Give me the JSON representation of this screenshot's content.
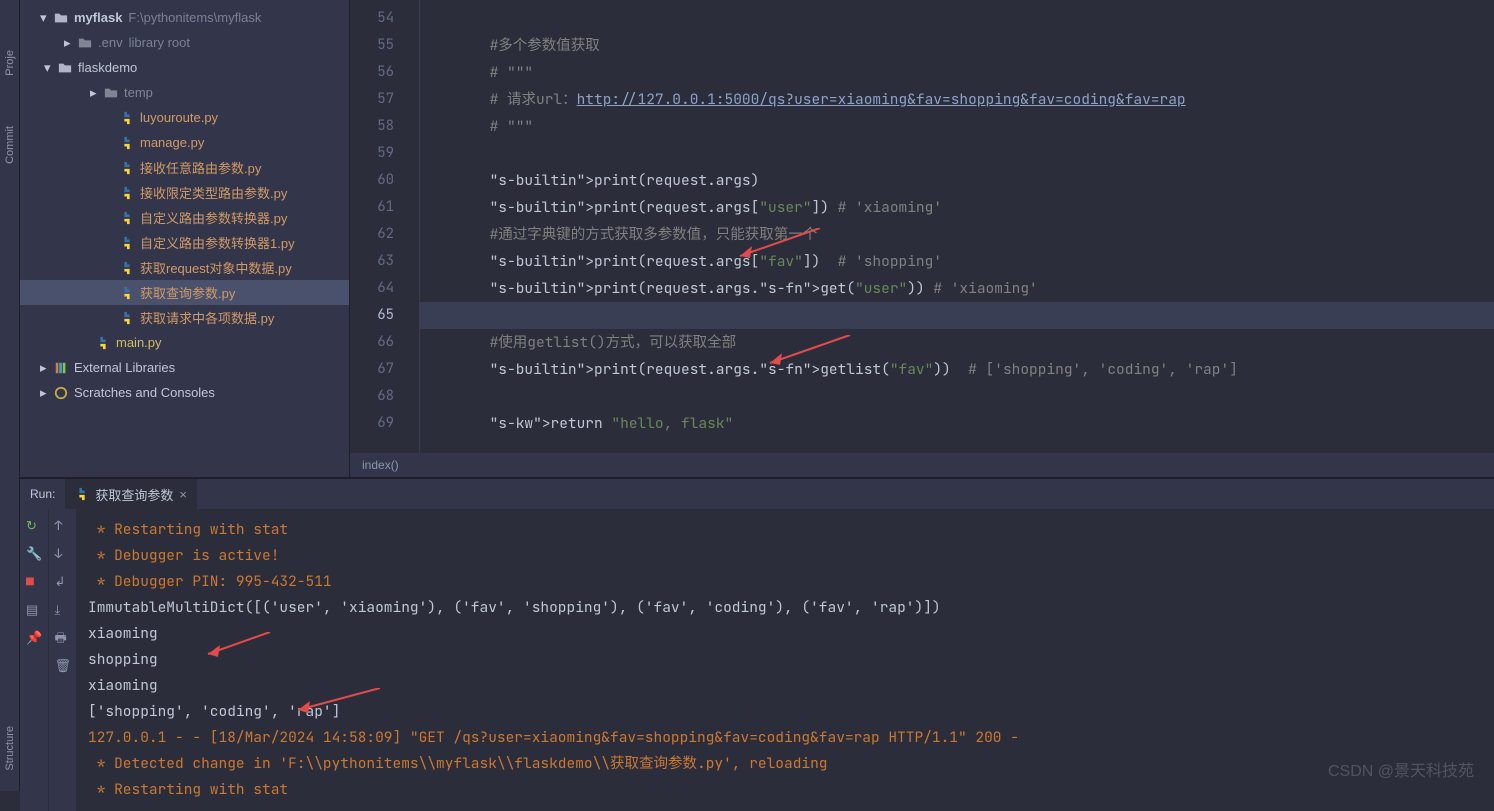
{
  "leftbar": {
    "commit": "Commit",
    "project": "Proje",
    "structure": "Structure"
  },
  "tree": {
    "root": {
      "name": "myflask",
      "path": "F:\\pythonitems\\myflask"
    },
    "env": {
      "name": ".env",
      "tag": "library root"
    },
    "folder": "flaskdemo",
    "temp": "temp",
    "files": [
      "luyouroute.py",
      "manage.py",
      "接收任意路由参数.py",
      "接收限定类型路由参数.py",
      "自定义路由参数转换器.py",
      "自定义路由参数转换器1.py",
      "获取request对象中数据.py",
      "获取查询参数.py",
      "获取请求中各项数据.py"
    ],
    "selectedFile": "获取查询参数.py",
    "main": "main.py",
    "extlib": "External Libraries",
    "scratches": "Scratches and Consoles"
  },
  "editor": {
    "startLine": 54,
    "currentLine": 65,
    "lines": [
      "",
      "        #多个参数值获取",
      "        # \"\"\"",
      "        # 请求url：http://127.0.0.1:5000/qs?user=xiaoming&fav=shopping&fav=coding&fav=rap",
      "        # \"\"\"",
      "",
      "        print(request.args)",
      "        print(request.args[\"user\"]) # 'xiaoming'",
      "        #通过字典键的方式获取多参数值，只能获取第一个",
      "        print(request.args[\"fav\"])  # 'shopping'",
      "        print(request.args.get(\"user\")) # 'xiaoming'",
      "",
      "        #使用getlist()方式，可以获取全部",
      "        print(request.args.getlist(\"fav\"))  # ['shopping', 'coding', 'rap']",
      "",
      "        return \"hello, flask\""
    ],
    "crumb": "index()"
  },
  "run": {
    "label": "Run:",
    "tabName": "获取查询参数",
    "lines": [
      {
        "t": " * Restarting with stat",
        "c": "red"
      },
      {
        "t": " * Debugger is active!",
        "c": "red"
      },
      {
        "t": " * Debugger PIN: 995-432-511",
        "c": "red"
      },
      {
        "t": "ImmutableMultiDict([('user', 'xiaoming'), ('fav', 'shopping'), ('fav', 'coding'), ('fav', 'rap')])",
        "c": "white"
      },
      {
        "t": "xiaoming",
        "c": "white"
      },
      {
        "t": "shopping",
        "c": "white"
      },
      {
        "t": "xiaoming",
        "c": "white"
      },
      {
        "t": "['shopping', 'coding', 'rap']",
        "c": "white"
      },
      {
        "t": "127.0.0.1 - - [18/Mar/2024 14:58:09] \"GET /qs?user=xiaoming&fav=shopping&fav=coding&fav=rap HTTP/1.1\" 200 -",
        "c": "red"
      },
      {
        "t": " * Detected change in 'F:\\\\pythonitems\\\\myflask\\\\flaskdemo\\\\获取查询参数.py', reloading",
        "c": "red"
      },
      {
        "t": " * Restarting with stat",
        "c": "red"
      }
    ]
  },
  "watermark": "CSDN @景天科技苑"
}
